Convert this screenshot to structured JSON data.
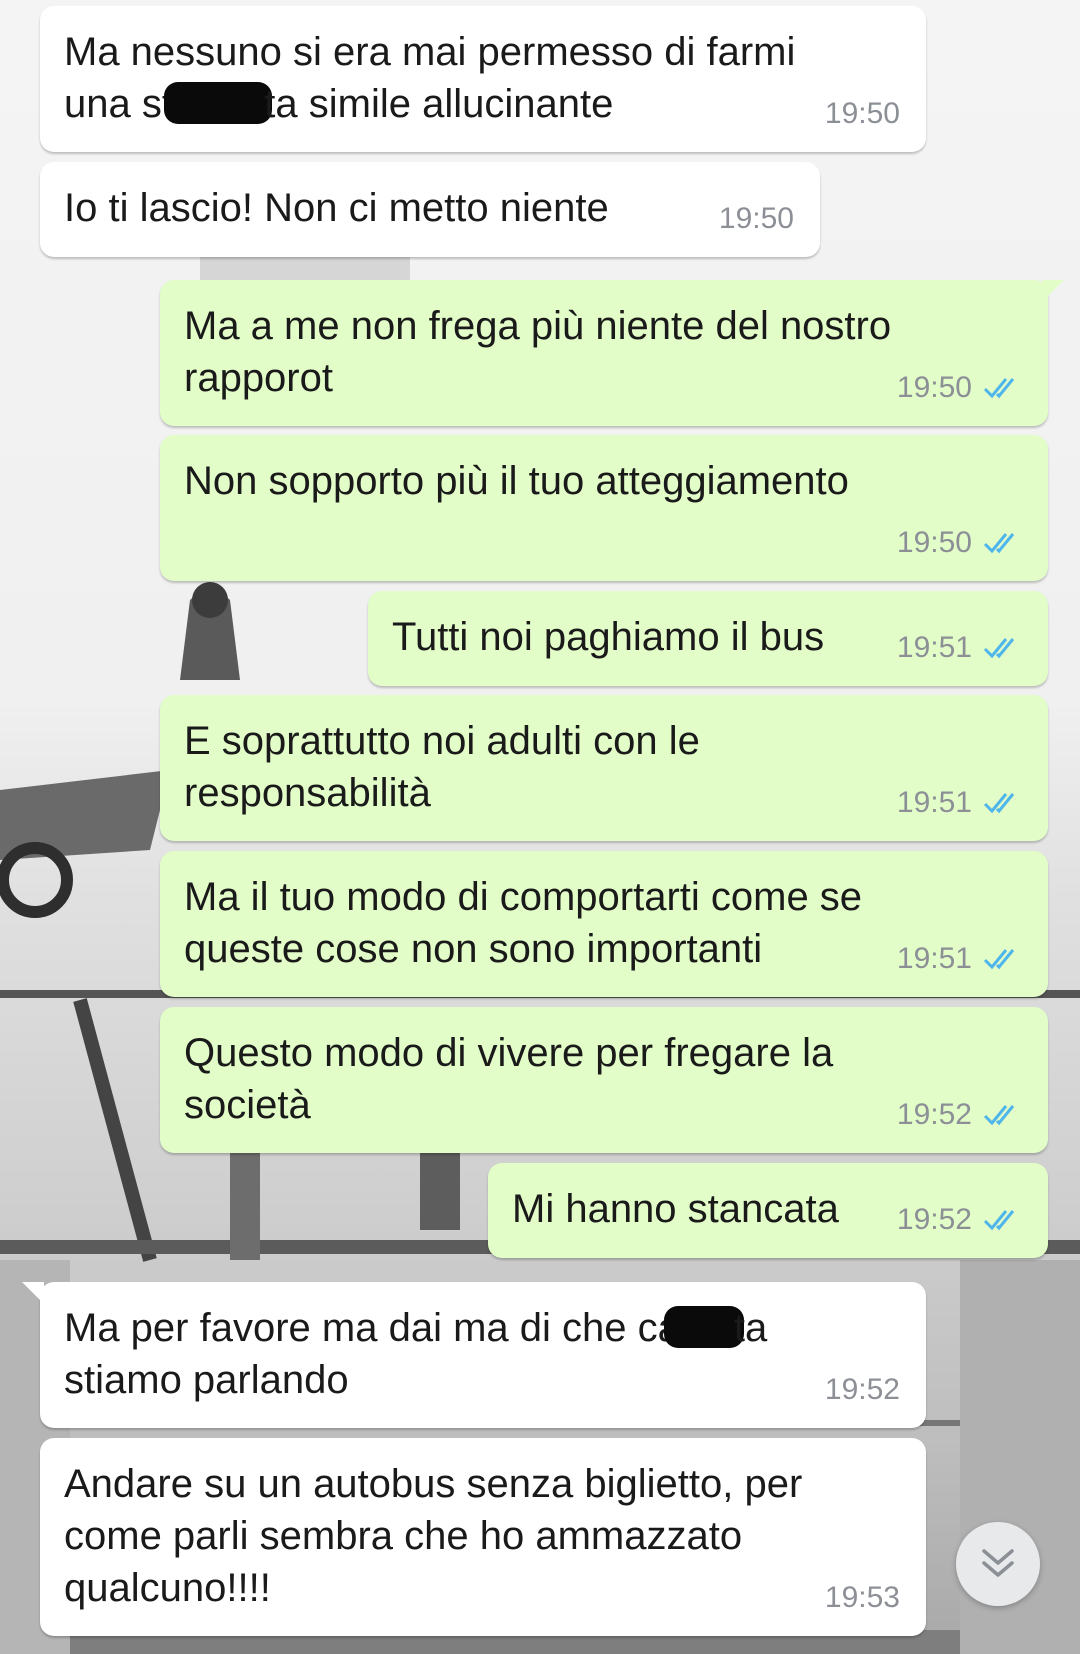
{
  "chat": {
    "messages": [
      {
        "id": "m1",
        "direction": "incoming",
        "parts": [
          "Ma nessuno si era mai permesso di farmi\nuna str",
          "",
          "ta simile allucinante"
        ],
        "time": "19:50"
      },
      {
        "id": "m2",
        "direction": "incoming",
        "text": "Io ti lascio! Non ci metto niente",
        "time": "19:50"
      },
      {
        "id": "m3",
        "direction": "outgoing",
        "text": "Ma a me non frega più niente del nostro\nrapporot",
        "time": "19:50",
        "status": "read"
      },
      {
        "id": "m4",
        "direction": "outgoing",
        "text": "Non sopporto più il tuo atteggiamento",
        "time": "19:50",
        "status": "read"
      },
      {
        "id": "m5",
        "direction": "outgoing",
        "text": "Tutti noi paghiamo il bus",
        "time": "19:51",
        "status": "read"
      },
      {
        "id": "m6",
        "direction": "outgoing",
        "text": "E soprattutto noi adulti con le\nresponsabilità",
        "time": "19:51",
        "status": "read"
      },
      {
        "id": "m7",
        "direction": "outgoing",
        "text": "Ma il tuo modo di comportarti come se\nqueste cose non sono importanti",
        "time": "19:51",
        "status": "read"
      },
      {
        "id": "m8",
        "direction": "outgoing",
        "text": "Questo modo di vivere per fregare la\nsocietà",
        "time": "19:52",
        "status": "read"
      },
      {
        "id": "m9",
        "direction": "outgoing",
        "text": "Mi hanno stancata",
        "time": "19:52",
        "status": "read"
      },
      {
        "id": "m10",
        "direction": "incoming",
        "parts": [
          "Ma per favore ma dai ma di che ca",
          "",
          "ta\nstiamo parlando"
        ],
        "time": "19:52"
      },
      {
        "id": "m11",
        "direction": "incoming",
        "text": "Andare su un autobus senza biglietto, per\ncome parli sembra che ho ammazzato\nqualcuno!!!!",
        "time": "19:53"
      }
    ]
  },
  "colors": {
    "incoming_bubble": "#ffffff",
    "outgoing_bubble": "#e2fdc8",
    "read_ticks": "#4fb6ec",
    "timestamp": "#8c9096"
  },
  "icons": {
    "read_receipt": "double-check-icon",
    "scroll_down": "chevron-double-down-icon"
  }
}
